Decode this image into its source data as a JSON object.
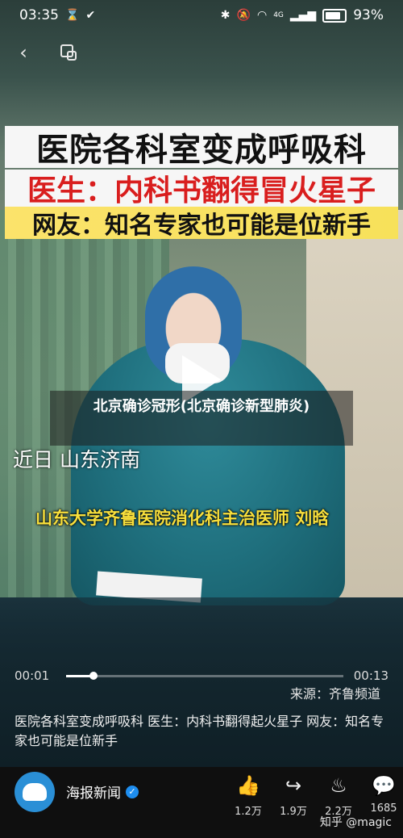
{
  "status_bar": {
    "time": "03:35",
    "left_icons": [
      "hourglass-icon",
      "check-icon"
    ],
    "right_icons": [
      "bluetooth-icon",
      "mute-icon",
      "wifi-icon",
      "signal-icon"
    ],
    "network_label": "4G",
    "battery": "93%"
  },
  "nav": {
    "back_icon": "back-arrow-icon",
    "pip_icon": "picture-in-picture-icon"
  },
  "banner": {
    "line1": "医院各科室变成呼吸科",
    "line2_prefix": "医生：",
    "line2_text": "内科书翻得冒火星子",
    "line3": "网友：知名专家也可能是位新手"
  },
  "video": {
    "title": "北京确诊冠形(北京确诊新型肺炎)",
    "subtitle_location": "近日  山东济南",
    "subtitle_doctor": "山东大学齐鲁医院消化科主治医师  刘晗",
    "current_time": "00:01",
    "total_time": "00:13",
    "progress": 0.1,
    "source": "来源：齐鲁频道"
  },
  "description": "医院各科室变成呼吸科 医生：内科书翻得起火星子 网友：知名专家也可能是位新手",
  "account": {
    "name": "海报新闻",
    "verified": true
  },
  "actions": [
    {
      "icon": "like-icon",
      "glyph": "👍",
      "count": "1.2万"
    },
    {
      "icon": "share-icon",
      "glyph": "↪",
      "count": "1.9万"
    },
    {
      "icon": "favorite-icon",
      "glyph": "♨",
      "count": "2.2万"
    },
    {
      "icon": "comment-icon",
      "glyph": "💬",
      "count": "1685"
    }
  ],
  "watermark": "知乎 @magic"
}
